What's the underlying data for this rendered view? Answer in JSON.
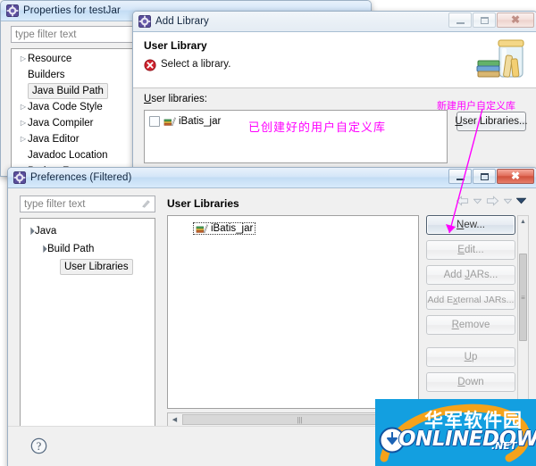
{
  "properties_window": {
    "title": "Properties for testJar",
    "icon": "eclipse-icon",
    "filter_placeholder": "type filter text",
    "tree_items": [
      {
        "label": "Resource",
        "expandable": true,
        "selected": false
      },
      {
        "label": "Builders",
        "expandable": false,
        "selected": false
      },
      {
        "label": "Java Build Path",
        "expandable": false,
        "selected": true
      },
      {
        "label": "Java Code Style",
        "expandable": true,
        "selected": false
      },
      {
        "label": "Java Compiler",
        "expandable": true,
        "selected": false
      },
      {
        "label": "Java Editor",
        "expandable": true,
        "selected": false
      },
      {
        "label": "Javadoc Location",
        "expandable": false,
        "selected": false
      },
      {
        "label": "Project Facets",
        "expandable": false,
        "selected": false
      }
    ]
  },
  "add_library_window": {
    "title": "Add Library",
    "icon": "eclipse-icon",
    "minimize_label": "Minimize",
    "maximize_label": "Maximize",
    "close_label": "Close",
    "page_title": "User Library",
    "error_icon": "error-icon",
    "error_message": "Select a library.",
    "banner_icon": "library-jar-icon",
    "list_label": "User libraries:",
    "list_label_mnemonic": "s",
    "libraries": [
      {
        "name": "iBatis_jar",
        "checked": false,
        "icon": "library-books-icon"
      }
    ],
    "user_libraries_button": "User Libraries...",
    "user_libraries_button_mnemonic": "U"
  },
  "preferences_window": {
    "title": "Preferences (Filtered)",
    "icon": "eclipse-icon",
    "minimize_label": "Minimize",
    "maximize_label": "Maximize",
    "close_label": "Close",
    "filter_placeholder": "type filter text",
    "filter_clear_icon": "clear-filter-icon",
    "tree": [
      {
        "label": "Java",
        "indent": 0,
        "expanded": true,
        "selected": false
      },
      {
        "label": "Build Path",
        "indent": 1,
        "expanded": true,
        "selected": false
      },
      {
        "label": "User Libraries",
        "indent": 2,
        "expanded": null,
        "selected": true
      }
    ],
    "page_heading": "User Libraries",
    "nav": {
      "back_icon": "arrow-left-icon",
      "back_dropdown_icon": "chevron-down-icon",
      "forward_icon": "arrow-right-icon",
      "forward_dropdown_icon": "chevron-down-icon",
      "menu_icon": "chevron-down-filled-icon"
    },
    "library_tree": [
      {
        "name": "iBatis_jar",
        "icon": "library-books-icon",
        "selected": true
      }
    ],
    "buttons": [
      {
        "label": "New...",
        "mnemonic": "N",
        "state": "focus"
      },
      {
        "label": "Edit...",
        "mnemonic": "E",
        "state": "disabled"
      },
      {
        "label": "Add JARs...",
        "mnemonic": "J",
        "state": "disabled"
      },
      {
        "label": "Add External JARs...",
        "mnemonic": "x",
        "state": "disabled"
      },
      {
        "label": "Remove",
        "mnemonic": "R",
        "state": "disabled"
      },
      {
        "label": "Up",
        "mnemonic": "U",
        "state": "disabled"
      },
      {
        "label": "Down",
        "mnemonic": "D",
        "state": "disabled"
      }
    ],
    "help_icon": "help-question-icon"
  },
  "annotations": [
    {
      "text": "已创建好的用户自定义库",
      "name": "annotation-existing-user-library"
    },
    {
      "text": "新建用户自定义库",
      "name": "annotation-new-user-library"
    }
  ],
  "watermark": {
    "text_cn": "华军软件园",
    "text_en": "ONLINEDOWN",
    "text_net": ".NET",
    "bg_color": "#139fe0",
    "accent_color": "#f5a21a"
  }
}
